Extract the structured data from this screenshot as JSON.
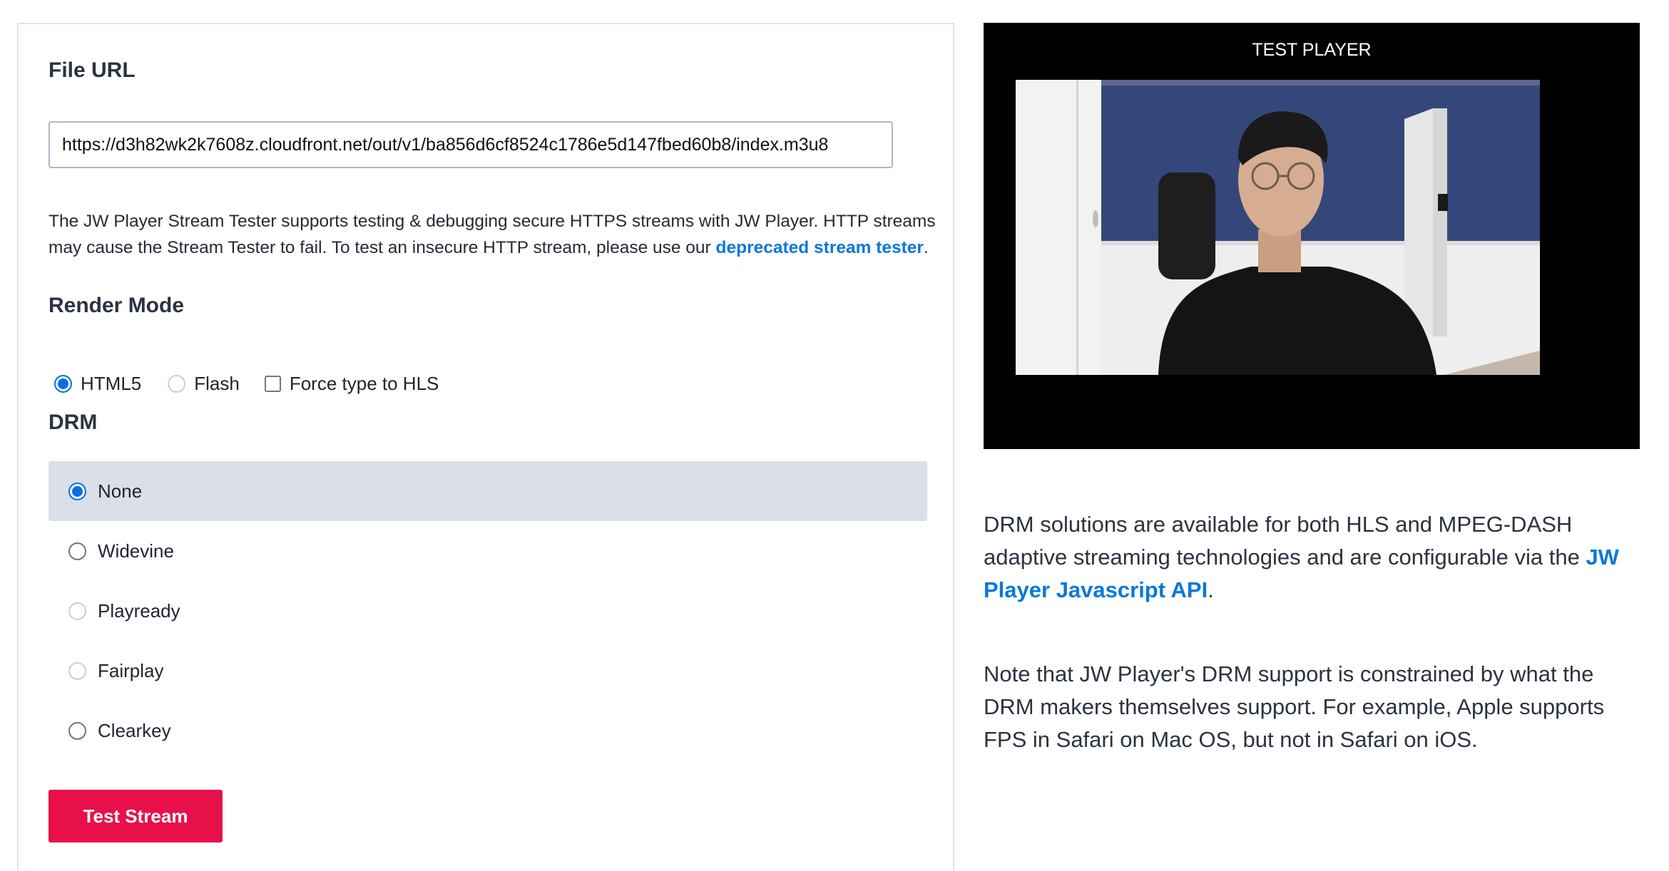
{
  "file_url": {
    "heading": "File URL",
    "value": "https://d3h82wk2k7608z.cloudfront.net/out/v1/ba856d6cf8524c1786e5d147fbed60b8/index.m3u8"
  },
  "description": {
    "text_before": "The JW Player Stream Tester supports testing & debugging secure HTTPS streams with JW Player. HTTP streams may cause the Stream Tester to fail. To test an insecure HTTP stream, please use our ",
    "link": "deprecated stream tester",
    "text_after": "."
  },
  "render_mode": {
    "heading": "Render Mode",
    "options": [
      {
        "label": "HTML5",
        "checked": true,
        "type": "radio"
      },
      {
        "label": "Flash",
        "checked": false,
        "type": "radio",
        "disabled": true
      },
      {
        "label": "Force type to HLS",
        "checked": false,
        "type": "checkbox"
      }
    ]
  },
  "drm": {
    "heading": "DRM",
    "options": [
      {
        "label": "None",
        "selected": true
      },
      {
        "label": "Widevine",
        "selected": false
      },
      {
        "label": "Playready",
        "selected": false,
        "disabled": true
      },
      {
        "label": "Fairplay",
        "selected": false,
        "disabled": true
      },
      {
        "label": "Clearkey",
        "selected": false
      }
    ]
  },
  "test_button": {
    "label": "Test Stream"
  },
  "player": {
    "title": "TEST PLAYER"
  },
  "info": {
    "para1_before": "DRM solutions are available for both HLS and MPEG-DASH adaptive streaming technologies and are configurable via the ",
    "para1_link": "JW Player Javascript API",
    "para1_after": ".",
    "para2": "Note that JW Player's DRM support is constrained by what the DRM makers themselves support. For example, Apple supports FPS in Safari on Mac OS, but not in Safari on iOS."
  },
  "colors": {
    "accent": "#0b78d8",
    "button": "#e8104a",
    "selected_row": "#dadfe8"
  }
}
